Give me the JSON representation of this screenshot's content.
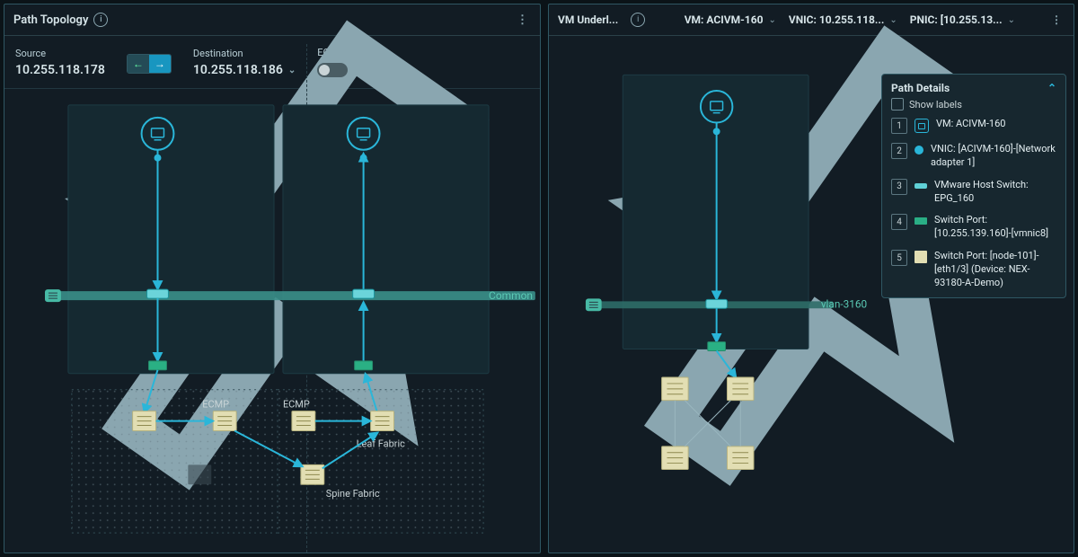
{
  "left": {
    "title": "Path Topology",
    "source_label": "Source",
    "source_value": "10.255.118.178",
    "dest_label": "Destination",
    "dest_value": "10.255.118.186",
    "ecmp_label": "ECMP",
    "common_label": "Common",
    "ecmp1": "ECMP",
    "ecmp2": "ECMP",
    "leaf_label": "Leaf Fabric",
    "spine_label": "Spine Fabric"
  },
  "right": {
    "title": "VM Underl...",
    "vm_sel": "VM: ACIVM-160",
    "vnic_sel": "VNIC: 10.255.118...",
    "pnic_sel": "PNIC: [10.255.13...",
    "vlan_label": "vlan-3160",
    "details": {
      "title": "Path Details",
      "show_labels": "Show labels",
      "steps": [
        {
          "n": "1",
          "text": "VM: ACIVM-160"
        },
        {
          "n": "2",
          "text": "VNIC: [ACIVM-160]-[Network adapter 1]"
        },
        {
          "n": "3",
          "text": "VMware Host Switch: EPG_160"
        },
        {
          "n": "4",
          "text": "Switch Port: [10.255.139.160]-[vmnic8]"
        },
        {
          "n": "5",
          "text": "Switch Port: [node-101]-[eth1/3] (Device: NEX-93180-A-Demo)"
        }
      ]
    }
  }
}
